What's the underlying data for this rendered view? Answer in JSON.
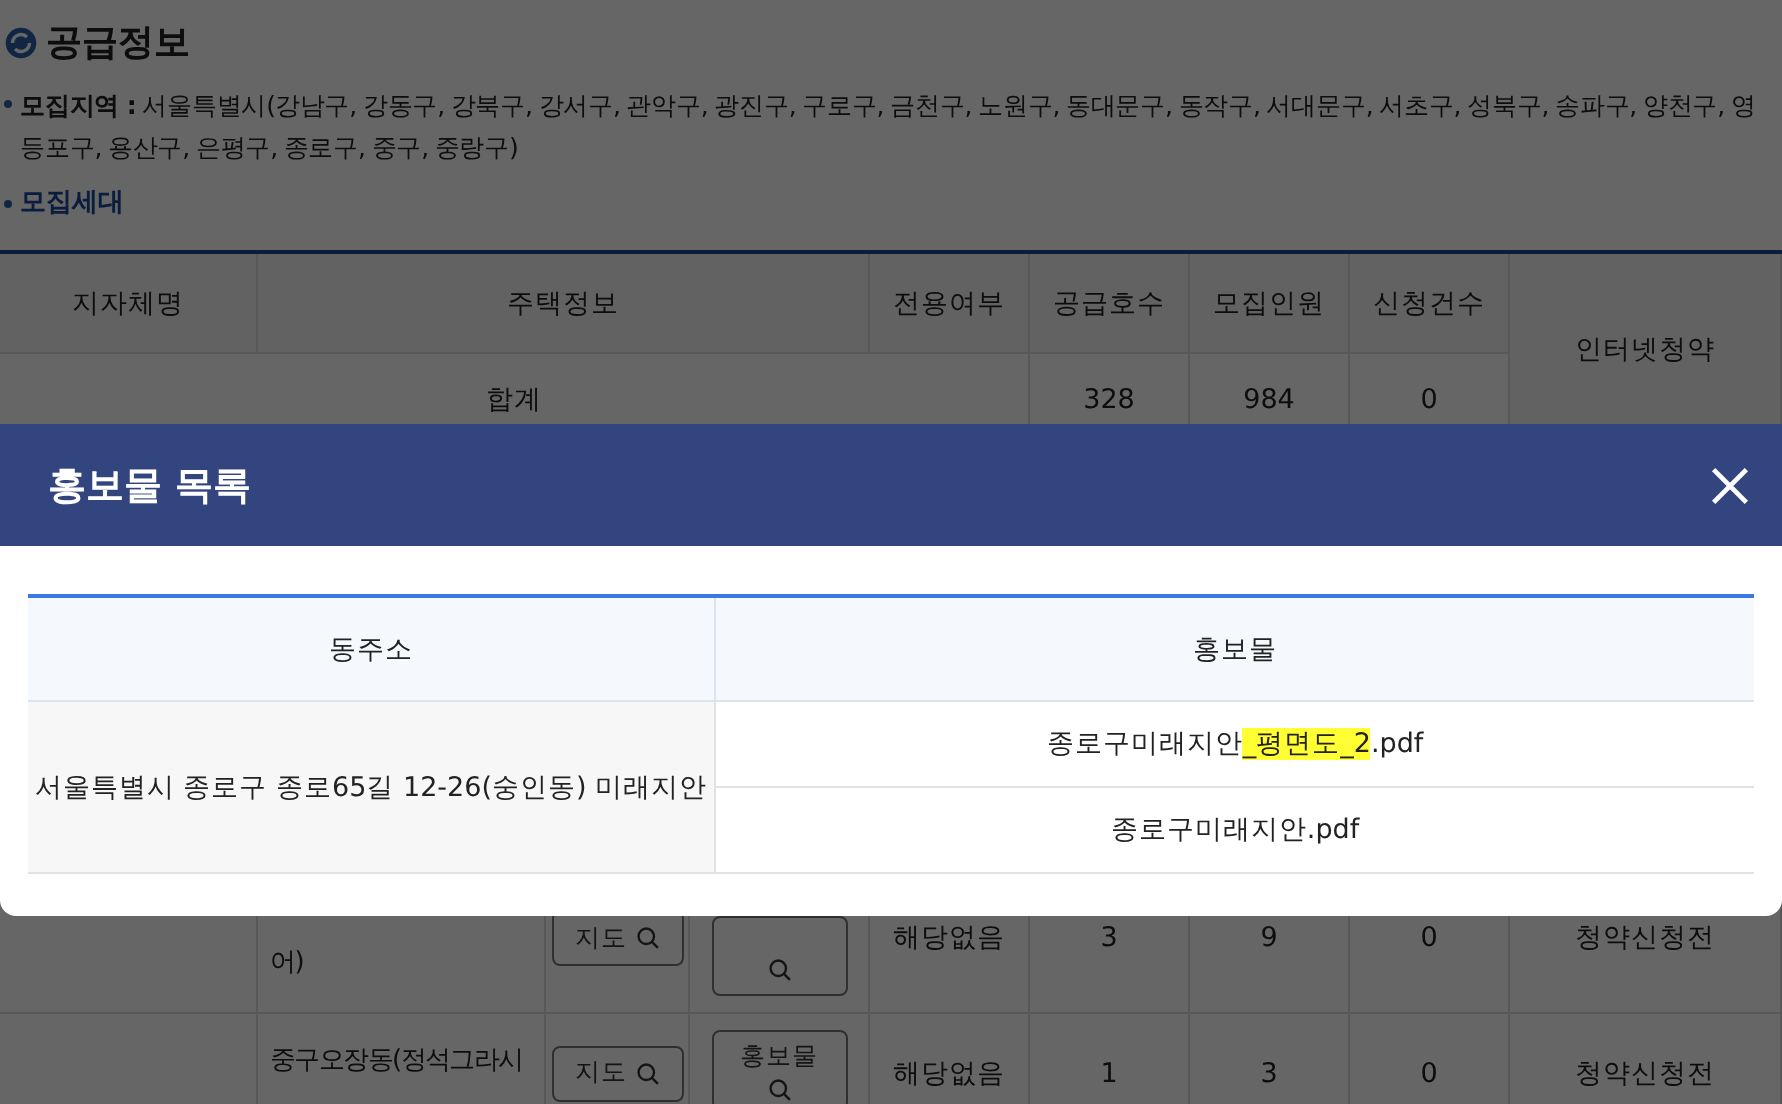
{
  "section": {
    "title": "공급정보",
    "region": "**모집지역 :** 서울특별시(강남구, 강동구, 강북구, 강서구, 관악구, 광진구, 구로구, 금천구, 노원구, 동대문구, 동작구, 서대문구, 서초구, 성북구, 송파구, 양천구, 영등포구, 용산구, 은평구, 종로구, 중구, 중랑구)",
    "households": "모집세대"
  },
  "table": {
    "columns": [
      "지자체명",
      "주택정보",
      "전용여부",
      "공급호수",
      "모집인원",
      "신청건수",
      "인터넷청약"
    ],
    "total": {
      "label": "합계",
      "supply": "328",
      "recruit": "984",
      "applications": "0"
    },
    "rows": [
      {
        "name": "어)",
        "map_button": "지도",
        "exclusive": "해당없음",
        "supply": "3",
        "recruit": "9",
        "applications": "0",
        "status": "청약신청전"
      },
      {
        "name": "중구오장동(정석그라시",
        "map_button": "지도",
        "brochure_button": "홍보물",
        "exclusive": "해당없음",
        "supply": "1",
        "recruit": "3",
        "applications": "0",
        "status": "청약신청전"
      }
    ]
  },
  "modal": {
    "title": "홍보물 목록",
    "columns": [
      "동주소",
      "홍보물"
    ],
    "address": "서울특별시 종로구 종로65길 12-26(숭인동) 미래지안",
    "files": [
      {
        "parts": [
          {
            "text": "종로구미래지안",
            "highlighted": false
          },
          {
            "text": "_평면도_2",
            "highlighted": true
          },
          {
            "text": ".pdf",
            "highlighted": false
          }
        ]
      },
      {
        "parts": [
          {
            "text": "종로구미래지안.pdf",
            "highlighted": false
          }
        ]
      }
    ]
  }
}
